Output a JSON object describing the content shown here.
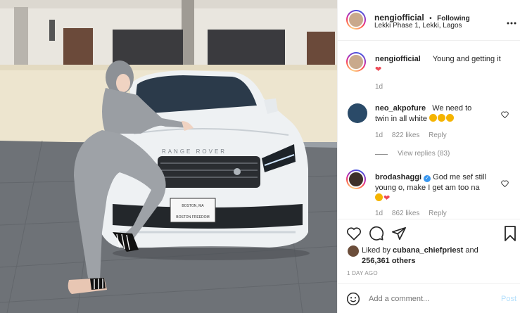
{
  "header": {
    "username": "nengiofficial",
    "separator": "•",
    "follow_label": "Following",
    "location": "Lekki Phase 1, Lekki, Lagos",
    "more_icon": "more-horizontal-icon"
  },
  "caption": {
    "username": "nengiofficial",
    "text": "Young and getting it",
    "emoji": "❤",
    "time": "1d"
  },
  "comments": [
    {
      "username": "neo_akpofure",
      "text_line1": "We need to",
      "text_line2": "twin in all white",
      "time": "1d",
      "likes": "822 likes",
      "reply_label": "Reply",
      "view_replies": "View replies (83)"
    },
    {
      "username": "brodashaggi",
      "text_line1": "God me sef still",
      "text_line2": "young o, make I get am too na",
      "time": "1d",
      "likes": "862 likes",
      "reply_label": "Reply"
    }
  ],
  "likes": {
    "prefix": "Liked by",
    "user": "cubana_chiefpriest",
    "conj": "and",
    "others": "256,361 others"
  },
  "timestamp": "1 DAY AGO",
  "add_comment": {
    "placeholder": "Add a comment...",
    "post_label": "Post"
  },
  "photo": {
    "plate_line1": "BOSTON, MA",
    "plate_line2": "BOSTON FREEDOM",
    "car_badge": "RANGE ROVER"
  },
  "colors": {
    "accent": "#0095f6",
    "post_disabled": "#b2dffc",
    "heart": "#ed4956",
    "muted": "#8e8e8e",
    "border": "#efefef"
  }
}
